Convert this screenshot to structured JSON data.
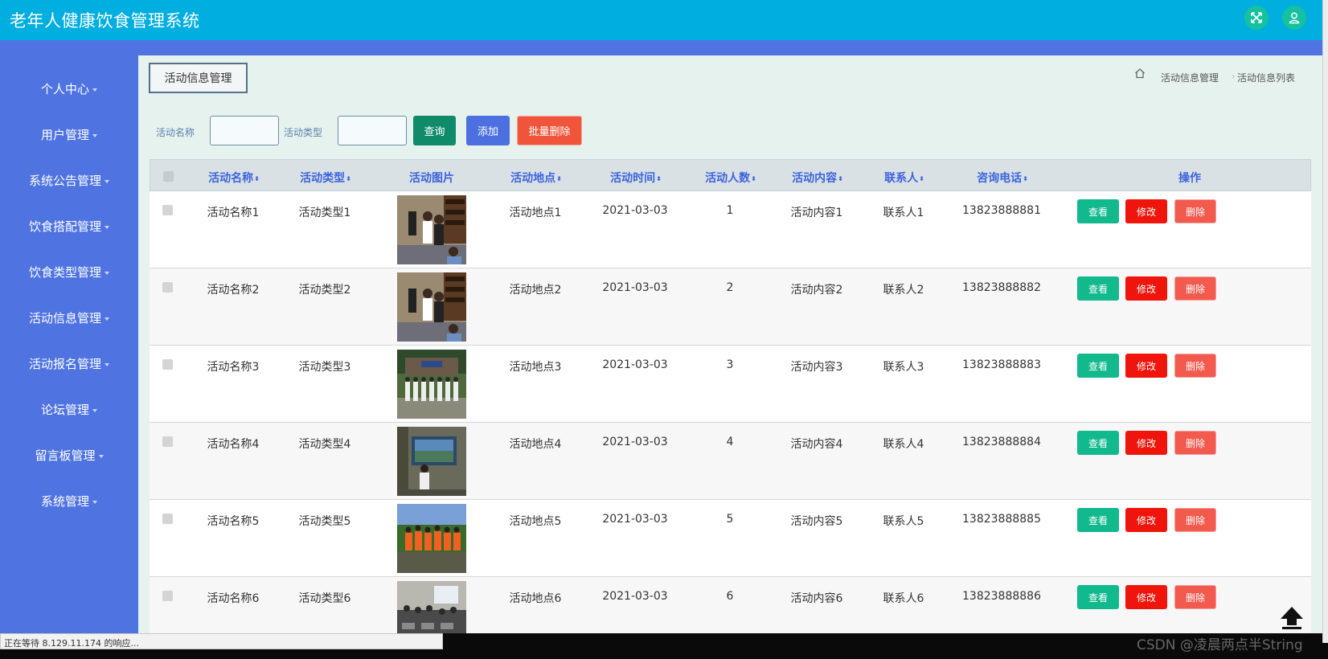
{
  "app": {
    "title": "老年人健康饮食管理系统"
  },
  "header": {
    "fullscreen_icon": "fullscreen-icon",
    "user_icon": "user-icon",
    "accent": "#00aee0"
  },
  "sidebar": {
    "items": [
      {
        "label": "个人中心"
      },
      {
        "label": "用户管理"
      },
      {
        "label": "系统公告管理"
      },
      {
        "label": "饮食搭配管理"
      },
      {
        "label": "饮食类型管理"
      },
      {
        "label": "活动信息管理"
      },
      {
        "label": "活动报名管理"
      },
      {
        "label": "论坛管理"
      },
      {
        "label": "留言板管理"
      },
      {
        "label": "系统管理"
      }
    ]
  },
  "page": {
    "section_title": "活动信息管理",
    "breadcrumb": {
      "home_icon": "home-icon",
      "level1": "活动信息管理",
      "level2": "活动信息列表"
    }
  },
  "search": {
    "name_label": "活动名称",
    "name_value": "",
    "type_label": "活动类型",
    "type_value": "",
    "query_button": "查询",
    "add_button": "添加",
    "batch_delete_button": "批量删除"
  },
  "table": {
    "columns": [
      "活动名称",
      "活动类型",
      "活动图片",
      "活动地点",
      "活动时间",
      "活动人数",
      "活动内容",
      "联系人",
      "咨询电话",
      "操作"
    ],
    "rows": [
      {
        "name": "活动名称1",
        "type": "活动类型1",
        "place": "活动地点1",
        "time": "2021-03-03",
        "count": "1",
        "content": "活动内容1",
        "contact": "联系人1",
        "phone": "13823888881"
      },
      {
        "name": "活动名称2",
        "type": "活动类型2",
        "place": "活动地点2",
        "time": "2021-03-03",
        "count": "2",
        "content": "活动内容2",
        "contact": "联系人2",
        "phone": "13823888882"
      },
      {
        "name": "活动名称3",
        "type": "活动类型3",
        "place": "活动地点3",
        "time": "2021-03-03",
        "count": "3",
        "content": "活动内容3",
        "contact": "联系人3",
        "phone": "13823888883"
      },
      {
        "name": "活动名称4",
        "type": "活动类型4",
        "place": "活动地点4",
        "time": "2021-03-03",
        "count": "4",
        "content": "活动内容4",
        "contact": "联系人4",
        "phone": "13823888884"
      },
      {
        "name": "活动名称5",
        "type": "活动类型5",
        "place": "活动地点5",
        "time": "2021-03-03",
        "count": "5",
        "content": "活动内容5",
        "contact": "联系人5",
        "phone": "13823888885"
      },
      {
        "name": "活动名称6",
        "type": "活动类型6",
        "place": "活动地点6",
        "time": "2021-03-03",
        "count": "6",
        "content": "活动内容6",
        "contact": "联系人6",
        "phone": "13823888886"
      }
    ],
    "actions": {
      "view": "查看",
      "edit": "修改",
      "delete": "删除"
    }
  },
  "status_bar": {
    "text": "正在等待 8.129.11.174 的响应..."
  },
  "watermark": {
    "text": "CSDN @凌晨两点半String"
  }
}
